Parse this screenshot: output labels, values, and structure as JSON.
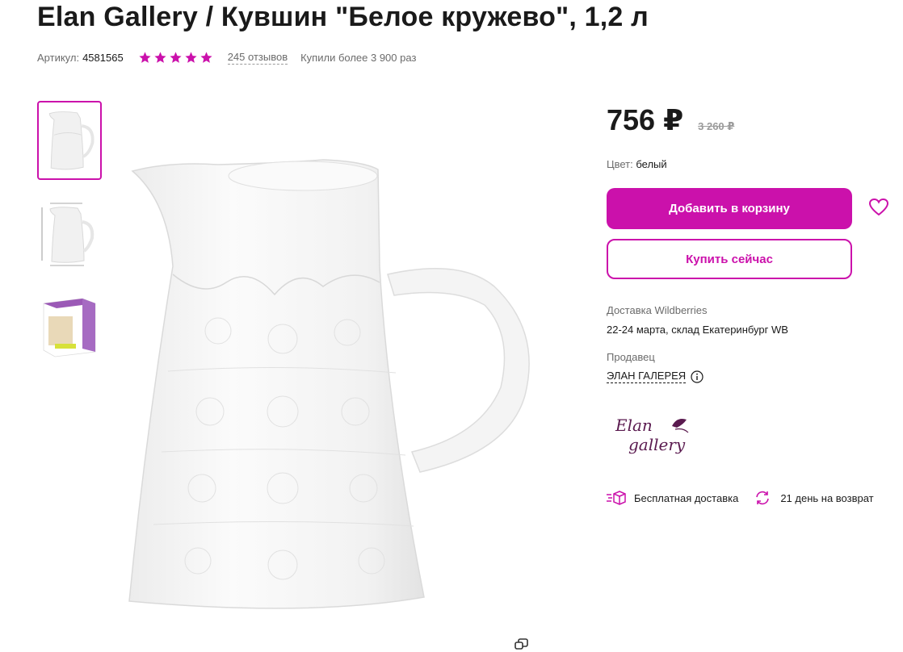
{
  "product": {
    "title": "Elan Gallery / Кувшин \"Белое кружево\", 1,2 л",
    "sku_label": "Артикул:",
    "sku_value": "4581565",
    "rating_stars": 5,
    "reviews_text": "245 отзывов",
    "bought_text": "Купили более 3 900 раз"
  },
  "gallery": {
    "thumbnails": [
      "jug-photo",
      "jug-dimensions-photo",
      "jug-box-photo"
    ],
    "selected_index": 0
  },
  "pricing": {
    "price": "756 ₽",
    "old_price": "3 260 ₽"
  },
  "color": {
    "label": "Цвет:",
    "value": "белый"
  },
  "actions": {
    "add_to_cart": "Добавить в корзину",
    "buy_now": "Купить сейчас",
    "favorite_icon": "heart-icon"
  },
  "delivery": {
    "label": "Доставка Wildberries",
    "value": "22-24 марта, склад Екатеринбург WB"
  },
  "seller": {
    "label": "Продавец",
    "name": "ЭЛАН ГАЛЕРЕЯ",
    "logo_line1": "Elan",
    "logo_line2": "gallery"
  },
  "perks": {
    "free_delivery": "Бесплатная доставка",
    "return_policy": "21 день на возврат"
  },
  "colors": {
    "accent": "#cb11ab",
    "text": "#1a1a1a",
    "muted": "#6b6b6b"
  }
}
